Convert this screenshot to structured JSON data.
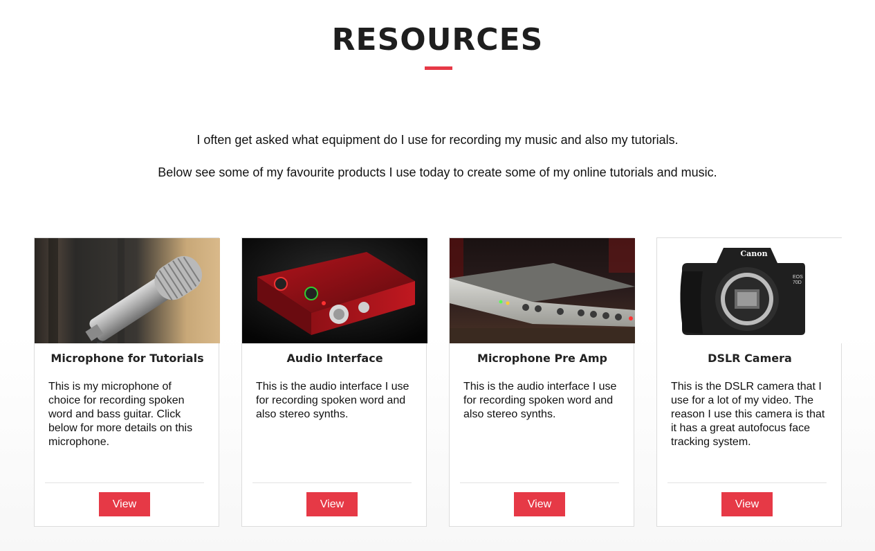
{
  "header": {
    "title": "RESOURCES",
    "accent_color": "#e63946"
  },
  "intro": {
    "line1": "I often get asked what equipment do I use for recording my music and also my tutorials.",
    "line2": "Below see some of my favourite products I use today to create some of my online tutorials and music."
  },
  "cards": [
    {
      "title": "Microphone for Tutorials",
      "description": "This is my microphone of choice for recording spoken word and bass guitar. Click below for more details on this microphone.",
      "button_label": "View",
      "image": "microphone-photo"
    },
    {
      "title": "Audio Interface",
      "description": "This is the audio interface I use for recording spoken word and also stereo synths.",
      "button_label": "View",
      "image": "audio-interface-photo"
    },
    {
      "title": "Microphone Pre Amp",
      "description": "This is the audio interface I use for recording spoken word and also stereo synths.",
      "button_label": "View",
      "image": "preamp-photo"
    },
    {
      "title": "DSLR Camera",
      "description": "This is the DSLR camera that I use for a lot of my video. The reason I use this camera is that it has a great autofocus face tracking system.",
      "button_label": "View",
      "image": "dslr-camera-photo",
      "image_text": {
        "brand": "Canon",
        "model_line1": "EOS",
        "model_line2": "70D"
      }
    }
  ]
}
